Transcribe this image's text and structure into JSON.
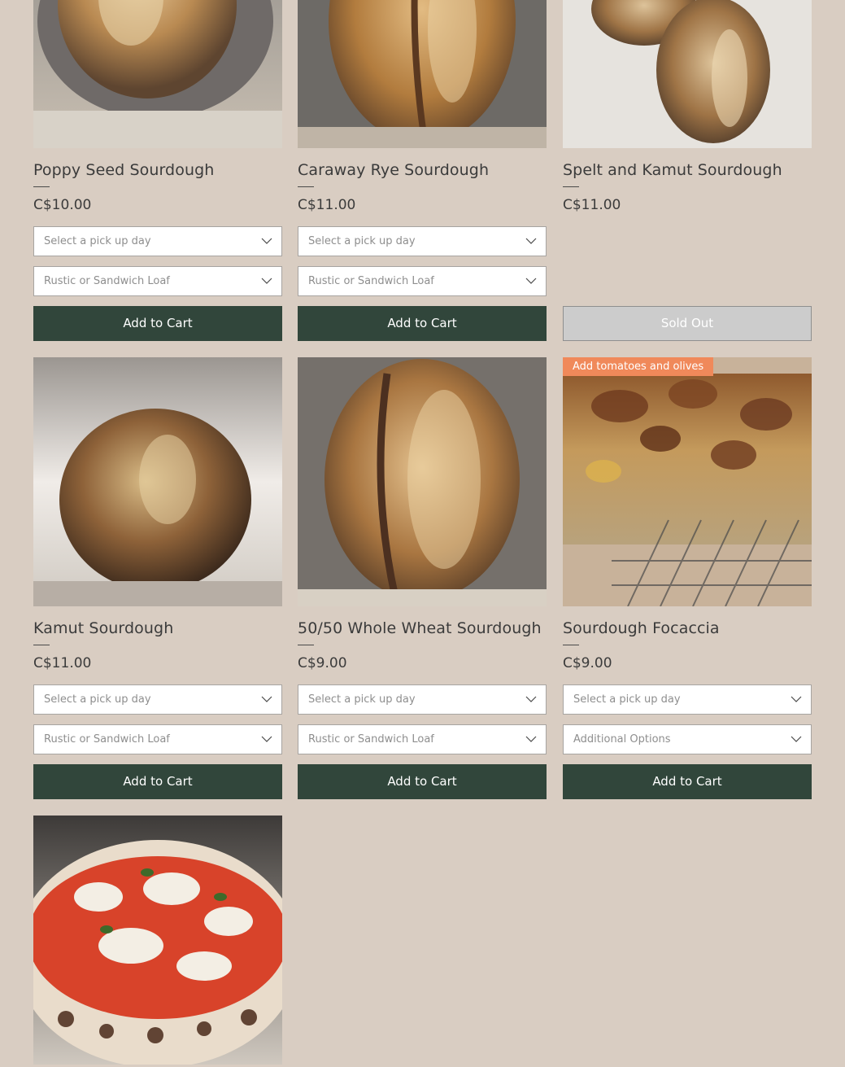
{
  "products": [
    {
      "name": "Poppy Seed Sourdough",
      "price": "C$10.00",
      "image_icon": "bread-loaf-image",
      "pickup_placeholder": "Select a pick up day",
      "option_placeholder": "Rustic or Sandwich Loaf",
      "button_label": "Add to Cart"
    },
    {
      "name": "Caraway Rye Sourdough",
      "price": "C$11.00",
      "image_icon": "bread-loaf-image",
      "pickup_placeholder": "Select a pick up day",
      "option_placeholder": "Rustic or Sandwich Loaf",
      "button_label": "Add to Cart"
    },
    {
      "name": "Spelt and Kamut Sourdough",
      "price": "C$11.00",
      "image_icon": "bread-loaf-image",
      "button_label": "Sold Out"
    },
    {
      "name": "Kamut Sourdough",
      "price": "C$11.00",
      "image_icon": "bread-loaf-image",
      "pickup_placeholder": "Select a pick up day",
      "option_placeholder": "Rustic or Sandwich Loaf",
      "button_label": "Add to Cart"
    },
    {
      "name": "50/50 Whole Wheat Sourdough",
      "price": "C$9.00",
      "image_icon": "bread-loaf-image",
      "pickup_placeholder": "Select a pick up day",
      "option_placeholder": "Rustic or Sandwich Loaf",
      "button_label": "Add to Cart"
    },
    {
      "name": "Sourdough Focaccia",
      "price": "C$9.00",
      "ribbon": "Add tomatoes and olives",
      "image_icon": "focaccia-image",
      "pickup_placeholder": "Select a pick up day",
      "option_placeholder": "Additional Options",
      "button_label": "Add to Cart"
    },
    {
      "image_icon": "pizza-image"
    }
  ],
  "colors": {
    "background": "#d9cdc2",
    "button": "#31463b",
    "sold_out": "#cccccc",
    "ribbon": "#f0895a"
  }
}
